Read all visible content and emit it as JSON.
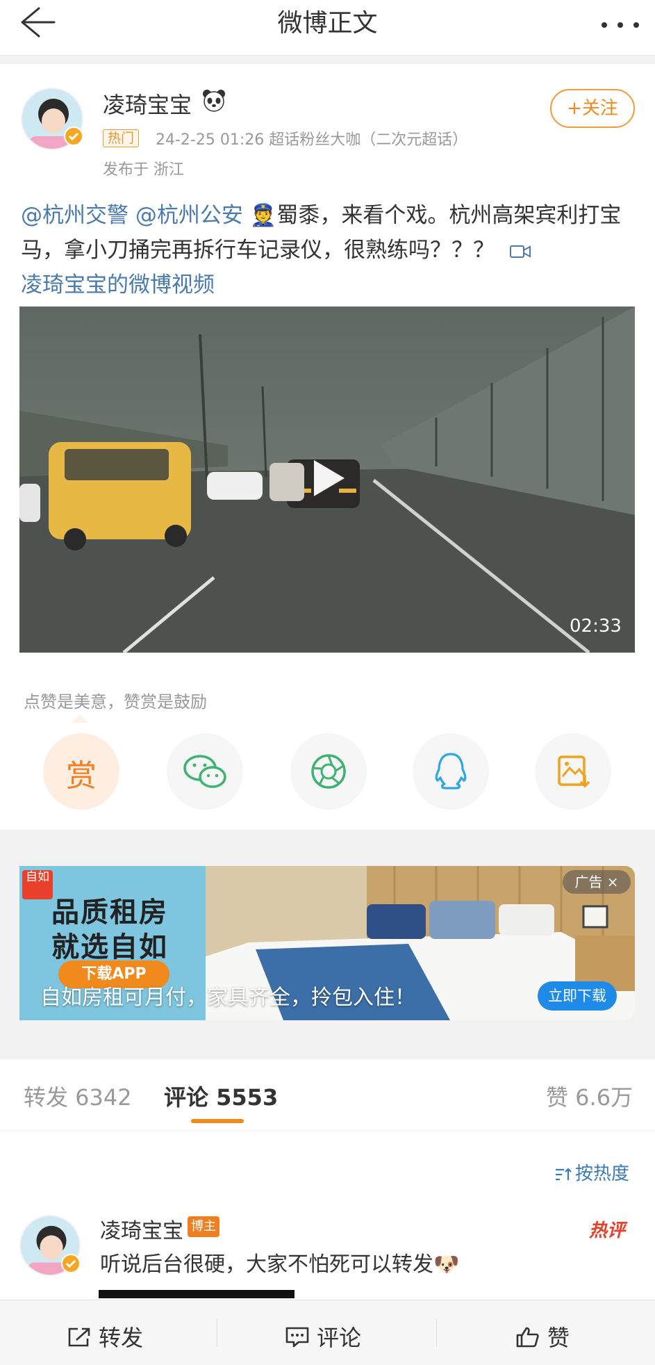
{
  "header": {
    "title": "微博正文"
  },
  "post": {
    "author": "凌琦宝宝",
    "hot_badge": "热门",
    "meta": "24-2-25 01:26   超话粉丝大咖（二次元超话）",
    "location": "发布于 浙江",
    "follow_label": "+关注",
    "mention_1": "@杭州交警",
    "mention_2": "@杭州公安",
    "text_main": "👮蜀黍，来看个戏。杭州高架宾利打宝马，拿小刀捅完再拆行车记录仪，很熟练吗？？？",
    "video_link": "凌琦宝宝的微博视频",
    "video_duration": "02:33",
    "tip": "点赞是美意，赞赏是鼓励",
    "reward_label": "赏"
  },
  "ad": {
    "logo_text": "自如",
    "title_line1": "品质租房",
    "title_line2": "就选自如",
    "app_label": "下载APP",
    "tag": "广告 ×",
    "caption": "自如房租可月付，家具齐全，拎包入住！",
    "cta": "立即下载"
  },
  "tabs": {
    "forward": "转发 6342",
    "comment": "评论 5553",
    "like": "赞 6.6万"
  },
  "sort_label": "按热度",
  "comment": {
    "author": "凌琦宝宝",
    "badge": "博主",
    "hot_tag": "热评",
    "text": "听说后台很硬，大家不怕死可以转发🐶"
  },
  "bottom_bar": {
    "forward": "转发",
    "comment": "评论",
    "like": "赞"
  }
}
